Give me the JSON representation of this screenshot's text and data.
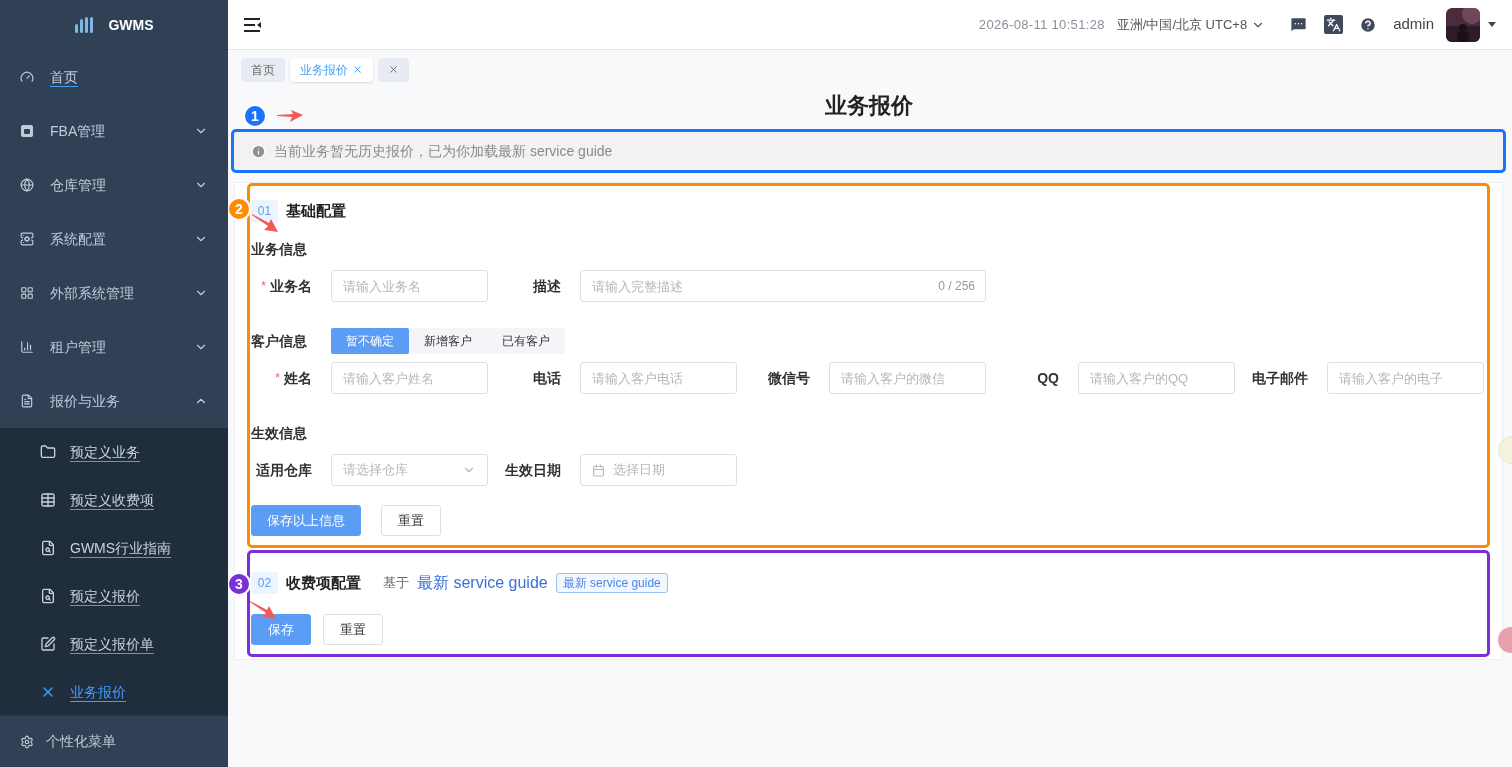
{
  "sidebar": {
    "logo_text": "GWMS",
    "items": [
      {
        "label": "首页",
        "kind": "link"
      },
      {
        "label": "FBA管理",
        "kind": "group",
        "expanded": false
      },
      {
        "label": "仓库管理",
        "kind": "group",
        "expanded": false
      },
      {
        "label": "系统配置",
        "kind": "group",
        "expanded": false
      },
      {
        "label": "外部系统管理",
        "kind": "group",
        "expanded": false
      },
      {
        "label": "租户管理",
        "kind": "group",
        "expanded": false
      },
      {
        "label": "报价与业务",
        "kind": "group",
        "expanded": true,
        "children": [
          {
            "label": "预定义业务",
            "selected": false
          },
          {
            "label": "预定义收费项",
            "selected": false
          },
          {
            "label": "GWMS行业指南",
            "selected": false
          },
          {
            "label": "预定义报价",
            "selected": false
          },
          {
            "label": "预定义报价单",
            "selected": false
          },
          {
            "label": "业务报价",
            "selected": true
          }
        ]
      }
    ],
    "footer": "个性化菜单"
  },
  "header": {
    "datetime": "2026-08-11 10:51:28",
    "timezone": "亚洲/中国/北京 UTC+8",
    "user": "admin"
  },
  "tabs": [
    {
      "label": "首页",
      "selected": false,
      "closable": false
    },
    {
      "label": "业务报价",
      "selected": true,
      "closable": true
    },
    {
      "selected": false,
      "closable": true
    }
  ],
  "page_title": "业务报价",
  "alert": "当前业务暂无历史报价，已为你加载最新 service guide",
  "annotations": [
    {
      "number": "1",
      "color": "#1a73ff"
    },
    {
      "number": "2",
      "color": "#ff8c00"
    },
    {
      "number": "3",
      "color": "#7b2fd6"
    }
  ],
  "section_basic": {
    "number": "01",
    "title": "基础配置",
    "groups": [
      {
        "title": "业务信息",
        "fields": [
          {
            "kind": "input",
            "label": "业务名",
            "required_mark": "*",
            "placeholder": "请输入业务名"
          },
          {
            "kind": "input",
            "label": "描述",
            "placeholder": "请输入完整描述",
            "counter": "0 / 256"
          }
        ]
      },
      {
        "title": "客户信息",
        "options": [
          {
            "label": "暂不确定",
            "selected": true
          },
          {
            "label": "新增客户",
            "selected": false
          },
          {
            "label": "已有客户",
            "selected": false
          }
        ],
        "fields": [
          {
            "kind": "input",
            "label": "姓名",
            "required_mark": "*",
            "placeholder": "请输入客户姓名"
          },
          {
            "kind": "input",
            "label": "电话",
            "placeholder": "请输入客户电话"
          },
          {
            "kind": "input",
            "label": "微信号",
            "placeholder": "请输入客户的微信"
          },
          {
            "kind": "input",
            "label": "QQ",
            "placeholder": "请输入客户的QQ"
          },
          {
            "kind": "input",
            "label": "电子邮件",
            "placeholder": "请输入客户的电子"
          }
        ]
      },
      {
        "title": "生效信息",
        "fields": [
          {
            "kind": "select",
            "label": "适用仓库",
            "placeholder": "请选择仓库"
          },
          {
            "kind": "date",
            "label": "生效日期",
            "placeholder": "选择日期"
          }
        ]
      }
    ],
    "buttons": [
      {
        "label": "保存以上信息",
        "kind": "primary"
      },
      {
        "label": "重置",
        "kind": "default"
      }
    ]
  },
  "section_fees": {
    "number": "02",
    "title": "收费项配置",
    "based_on": "基于",
    "link": "最新 service guide",
    "tag": "最新 service guide",
    "buttons": [
      {
        "label": "保存",
        "kind": "primary"
      },
      {
        "label": "重置",
        "kind": "default"
      }
    ]
  }
}
